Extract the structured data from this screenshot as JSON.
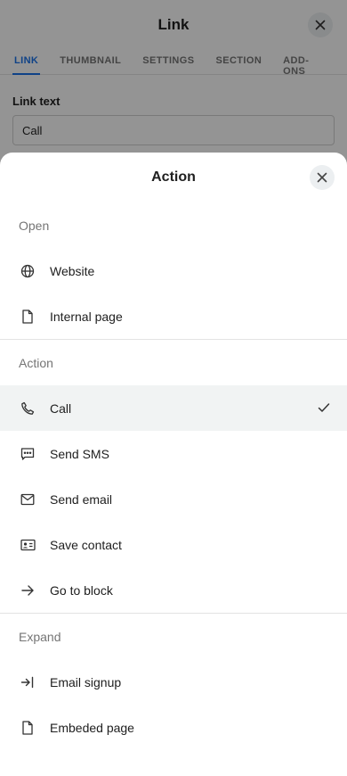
{
  "background": {
    "title": "Link",
    "tabs": [
      {
        "label": "LINK",
        "active": true
      },
      {
        "label": "THUMBNAIL",
        "active": false
      },
      {
        "label": "SETTINGS",
        "active": false
      },
      {
        "label": "SECTION",
        "active": false
      },
      {
        "label": "ADD-ONS",
        "active": false
      }
    ],
    "field_label": "Link text",
    "field_value": "Call"
  },
  "sheet": {
    "title": "Action",
    "sections": [
      {
        "label": "Open",
        "items": [
          {
            "label": "Website",
            "icon": "globe-icon",
            "selected": false
          },
          {
            "label": "Internal page",
            "icon": "page-icon",
            "selected": false
          }
        ]
      },
      {
        "label": "Action",
        "items": [
          {
            "label": "Call",
            "icon": "phone-icon",
            "selected": true
          },
          {
            "label": "Send SMS",
            "icon": "sms-icon",
            "selected": false
          },
          {
            "label": "Send email",
            "icon": "email-icon",
            "selected": false
          },
          {
            "label": "Save contact",
            "icon": "contact-card-icon",
            "selected": false
          },
          {
            "label": "Go to block",
            "icon": "arrow-right-icon",
            "selected": false
          }
        ]
      },
      {
        "label": "Expand",
        "items": [
          {
            "label": "Email signup",
            "icon": "login-icon",
            "selected": false
          },
          {
            "label": "Embeded page",
            "icon": "page-icon",
            "selected": false
          }
        ]
      }
    ]
  },
  "colors": {
    "accent": "#1a73e8",
    "selected_bg": "#f1f3f3",
    "overlay": "rgba(0,0,0,0.42)"
  }
}
